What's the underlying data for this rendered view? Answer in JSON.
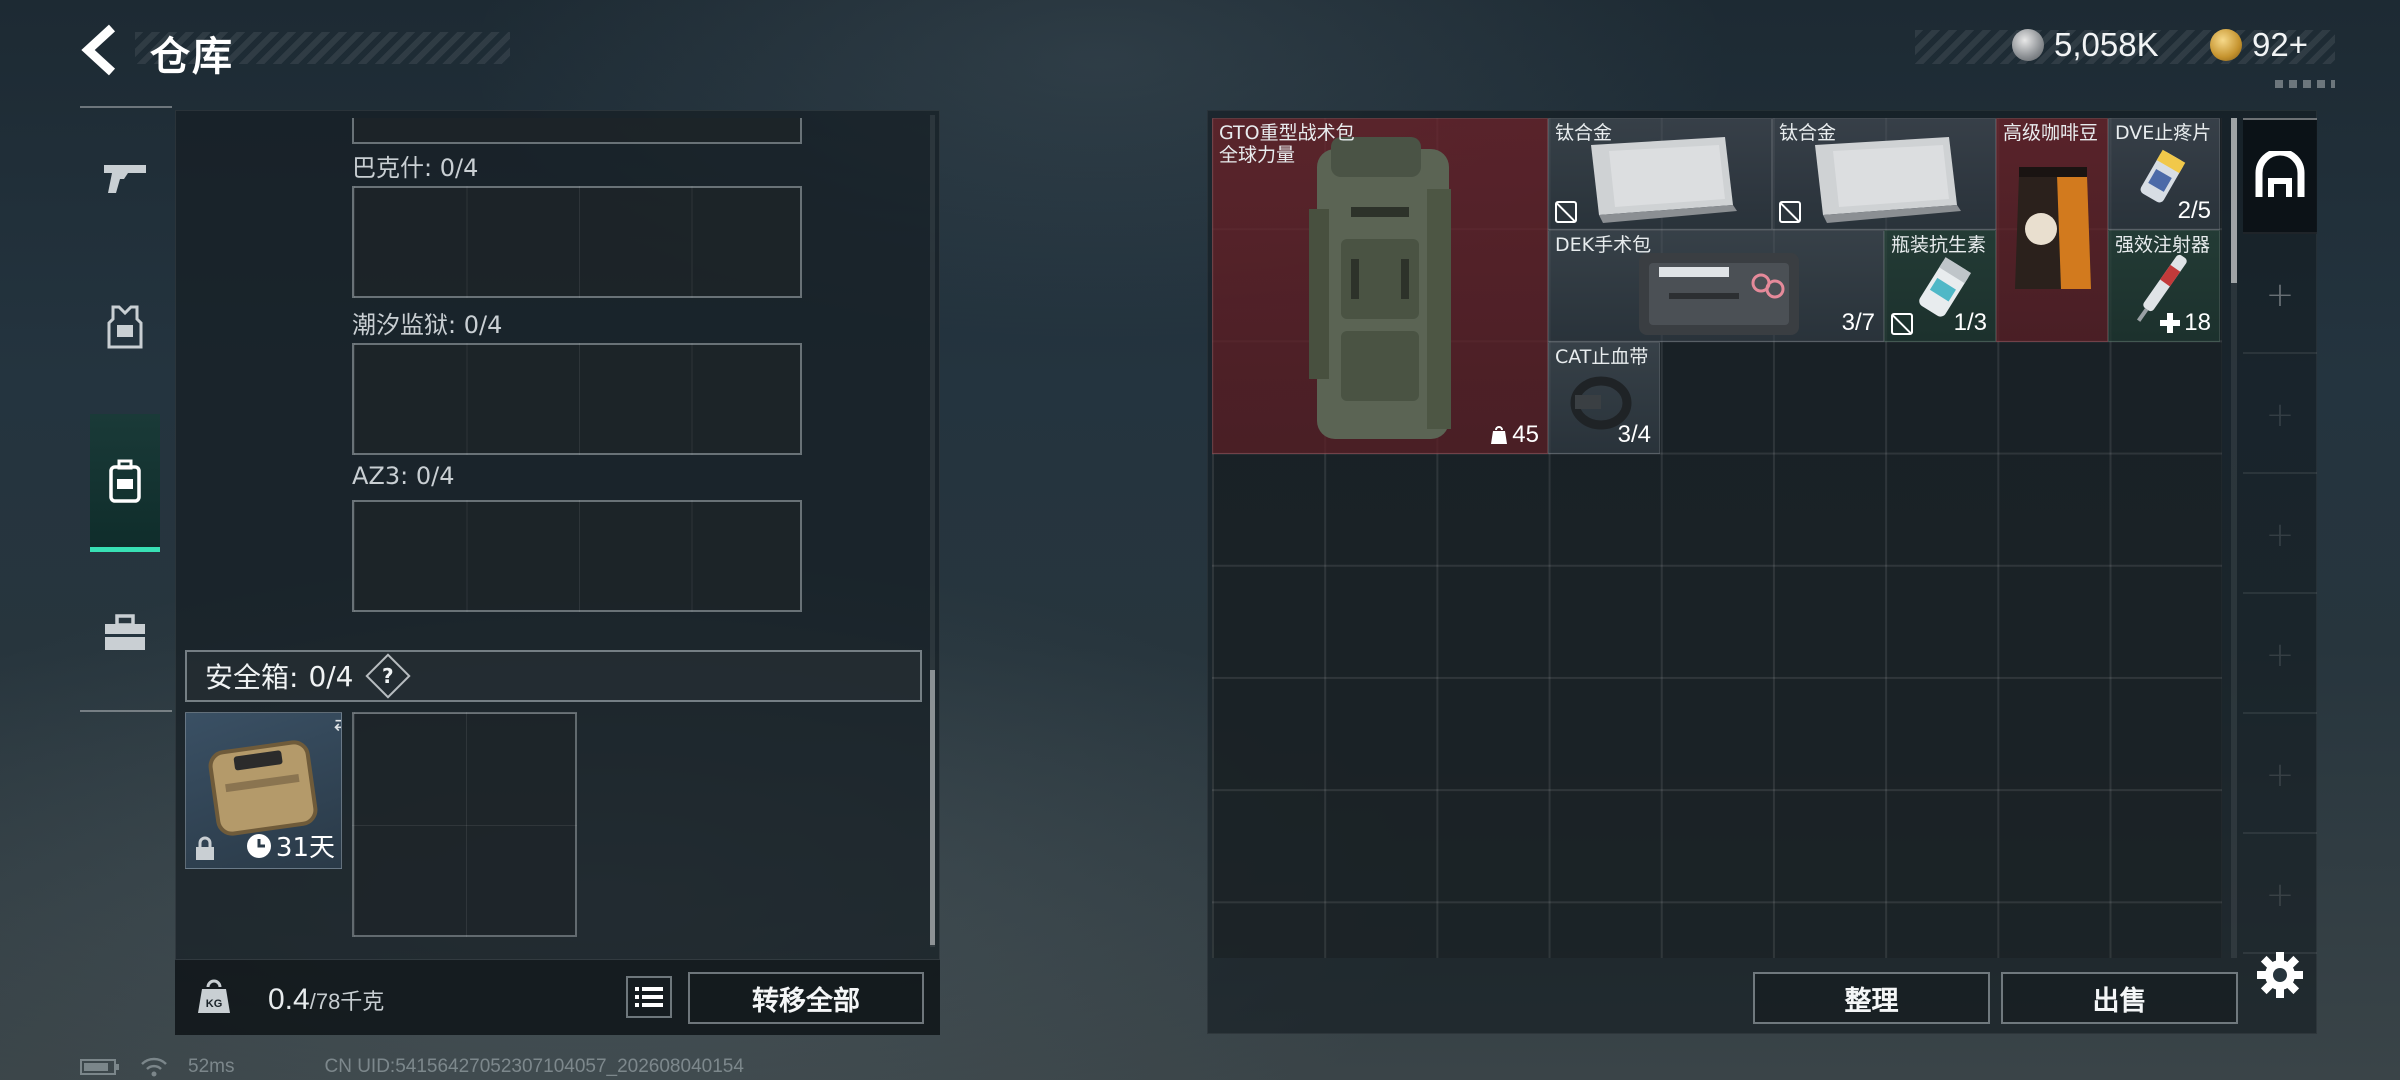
{
  "header": {
    "title": "仓库",
    "currencies": [
      {
        "name": "silver-coin",
        "value": "5,058K"
      },
      {
        "name": "gold-coin",
        "value": "92+"
      }
    ]
  },
  "sidebar": {
    "items": [
      {
        "name": "weapons",
        "icon": "gun-icon",
        "active": false
      },
      {
        "name": "armor",
        "icon": "vest-icon",
        "active": false
      },
      {
        "name": "backpack",
        "icon": "backpack-icon",
        "active": true
      },
      {
        "name": "cases",
        "icon": "briefcase-icon",
        "active": false
      }
    ]
  },
  "left_panel": {
    "slots": [
      {
        "label": "巴克什: 0/4"
      },
      {
        "label": "潮汐监狱: 0/4"
      },
      {
        "label": "AZ3: 0/4"
      }
    ],
    "safe_box": {
      "label": "安全箱:",
      "count": "0/4",
      "help": "?",
      "item_duration": "31天"
    },
    "weight": {
      "current": "0.4",
      "max": "/78千克"
    },
    "transfer_all": "转移全部"
  },
  "stash": {
    "items": [
      {
        "name": "GTO重型战术包",
        "subtitle": "全球力量",
        "count": "45",
        "rarity": "red"
      },
      {
        "name": "钛合金",
        "count": "",
        "rarity": "gray"
      },
      {
        "name": "钛合金",
        "count": "",
        "rarity": "gray"
      },
      {
        "name": "高级咖啡豆",
        "count": "",
        "rarity": "red"
      },
      {
        "name": "DVE止疼片",
        "count": "2/5",
        "rarity": "gray"
      },
      {
        "name": "DEK手术包",
        "count": "3/7",
        "rarity": "gray"
      },
      {
        "name": "瓶装抗生素",
        "count": "1/3",
        "rarity": "green"
      },
      {
        "name": "强效注射器",
        "count": "18",
        "rarity": "green"
      },
      {
        "name": "CAT止血带",
        "count": "3/4",
        "rarity": "gray"
      }
    ],
    "tidy": "整理",
    "sell": "出售"
  },
  "status": {
    "ping": "52ms",
    "uid": "CN UID:5415642705230710405​7_202608040154"
  },
  "colors": {
    "accent": "#38e0b4",
    "rarity_red": "#6e242c",
    "rarity_gray": "#505a64",
    "rarity_green": "#28463c"
  }
}
